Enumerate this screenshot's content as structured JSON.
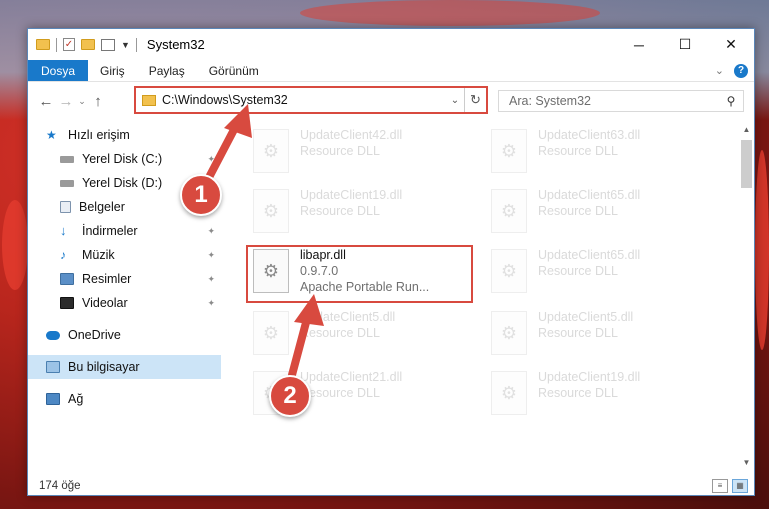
{
  "window": {
    "title": "System32"
  },
  "quick_access_toolbar": {
    "icons": [
      "folder-icon",
      "properties-icon",
      "new-folder-icon",
      "view-icon"
    ]
  },
  "ribbon": {
    "tabs": [
      "Dosya",
      "Giriş",
      "Paylaş",
      "Görünüm"
    ],
    "active_tab": "Dosya"
  },
  "address_bar": {
    "path": "C:\\Windows\\System32"
  },
  "search": {
    "placeholder": "Ara: System32"
  },
  "sidebar": {
    "items": [
      {
        "label": "Hızlı erişim",
        "icon": "star-icon",
        "pinned": false
      },
      {
        "label": "Yerel Disk (C:)",
        "icon": "drive-icon",
        "pinned": true
      },
      {
        "label": "Yerel Disk (D:)",
        "icon": "drive-icon",
        "pinned": true
      },
      {
        "label": "Belgeler",
        "icon": "documents-icon",
        "pinned": true
      },
      {
        "label": "İndirmeler",
        "icon": "download-icon",
        "pinned": true
      },
      {
        "label": "Müzik",
        "icon": "music-icon",
        "pinned": true
      },
      {
        "label": "Resimler",
        "icon": "pictures-icon",
        "pinned": true
      },
      {
        "label": "Videolar",
        "icon": "video-icon",
        "pinned": true
      },
      {
        "label": "OneDrive",
        "icon": "cloud-icon",
        "pinned": false
      },
      {
        "label": "Bu bilgisayar",
        "icon": "computer-icon",
        "pinned": false,
        "selected": true
      },
      {
        "label": "Ağ",
        "icon": "network-icon",
        "pinned": false
      }
    ]
  },
  "files": {
    "left": [
      {
        "name": "UpdateClient42.dll",
        "desc": "Resource DLL",
        "faded": true
      },
      {
        "name": "UpdateClient19.dll",
        "desc": "Resource DLL",
        "faded": true
      },
      {
        "name": "libapr.dll",
        "version": "0.9.7.0",
        "desc": "Apache Portable Run...",
        "faded": false,
        "highlighted": true
      },
      {
        "name": "UpdateClient5.dll",
        "desc": "Resource DLL",
        "faded": true
      },
      {
        "name": "UpdateClient21.dll",
        "desc": "Resource DLL",
        "faded": true
      }
    ],
    "right": [
      {
        "name": "UpdateClient63.dll",
        "desc": "Resource DLL",
        "faded": true
      },
      {
        "name": "UpdateClient65.dll",
        "desc": "Resource DLL",
        "faded": true
      },
      {
        "name": "UpdateClient65.dll",
        "desc": "Resource DLL",
        "faded": true
      },
      {
        "name": "UpdateClient5.dll",
        "desc": "Resource DLL",
        "faded": true
      },
      {
        "name": "UpdateClient19.dll",
        "desc": "Resource DLL",
        "faded": true
      }
    ]
  },
  "status": {
    "count": "174 öğe"
  },
  "annotations": {
    "step1": "1",
    "step2": "2",
    "color": "#d84a3f"
  }
}
